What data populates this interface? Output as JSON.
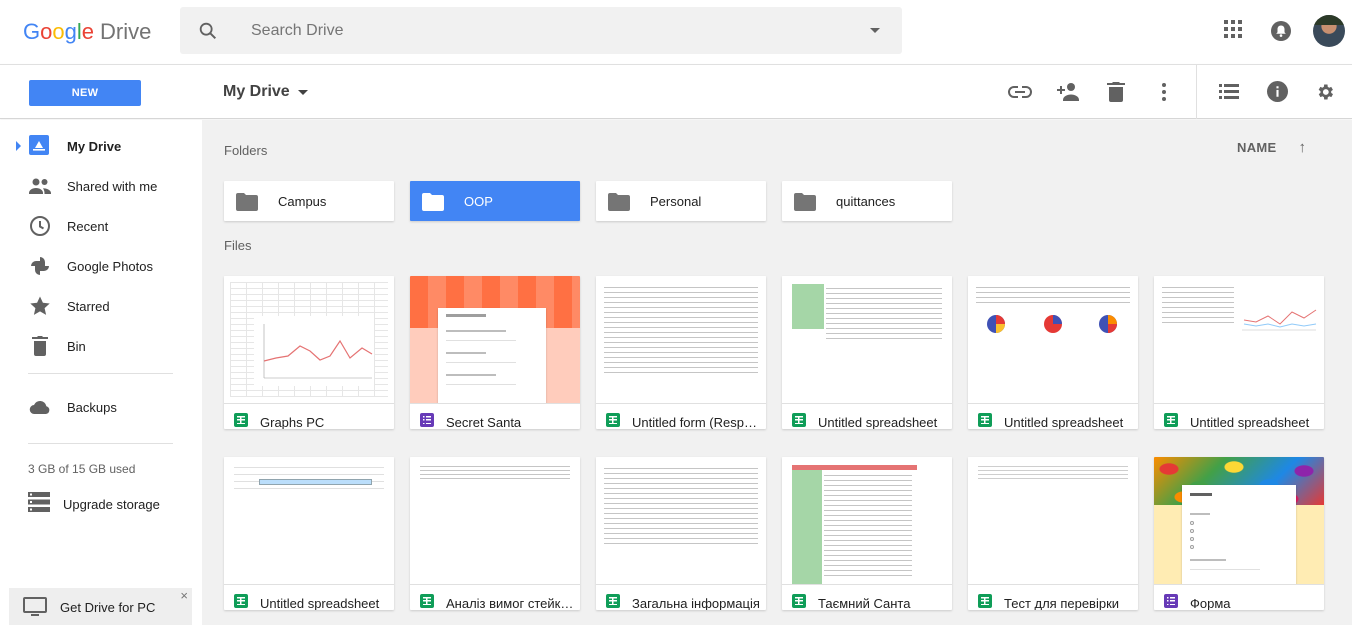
{
  "header": {
    "logo_google": "Google",
    "logo_product": "Drive",
    "search_placeholder": "Search Drive"
  },
  "toolbar": {
    "new_label": "NEW",
    "breadcrumb": "My Drive"
  },
  "sidebar": {
    "items": [
      {
        "label": "My Drive",
        "icon": "my-drive-icon",
        "active": true
      },
      {
        "label": "Shared with me",
        "icon": "shared-icon"
      },
      {
        "label": "Recent",
        "icon": "clock-icon"
      },
      {
        "label": "Google Photos",
        "icon": "photos-icon"
      },
      {
        "label": "Starred",
        "icon": "star-icon"
      },
      {
        "label": "Bin",
        "icon": "trash-icon"
      }
    ],
    "backups_label": "Backups",
    "quota": "3 GB of 15 GB used",
    "upgrade_label": "Upgrade storage",
    "get_drive_label": "Get Drive for PC",
    "close_glyph": "×"
  },
  "main": {
    "folders_title": "Folders",
    "files_title": "Files",
    "sort_label": "NAME",
    "sort_arrow": "↑",
    "folders": [
      {
        "name": "Campus"
      },
      {
        "name": "OOP",
        "selected": true
      },
      {
        "name": "Personal"
      },
      {
        "name": "quittances"
      }
    ],
    "files": [
      {
        "name": "Graphs PC",
        "type": "sheet"
      },
      {
        "name": "Secret Santa",
        "type": "form"
      },
      {
        "name": "Untitled form (Responses)",
        "type": "sheet"
      },
      {
        "name": "Untitled spreadsheet",
        "type": "sheet"
      },
      {
        "name": "Untitled spreadsheet",
        "type": "sheet"
      },
      {
        "name": "Untitled spreadsheet",
        "type": "sheet"
      },
      {
        "name": "Untitled spreadsheet",
        "type": "sheet"
      },
      {
        "name": "Аналіз вимог стейкхолдерів",
        "type": "sheet"
      },
      {
        "name": "Загальна інформація",
        "type": "sheet"
      },
      {
        "name": "Таємний Санта",
        "type": "sheet"
      },
      {
        "name": "Тест для перевірки",
        "type": "sheet"
      },
      {
        "name": "Форма",
        "type": "form"
      }
    ]
  },
  "colors": {
    "accent": "#4285f4",
    "sheet_green": "#0f9d58",
    "form_purple": "#673ab7"
  }
}
